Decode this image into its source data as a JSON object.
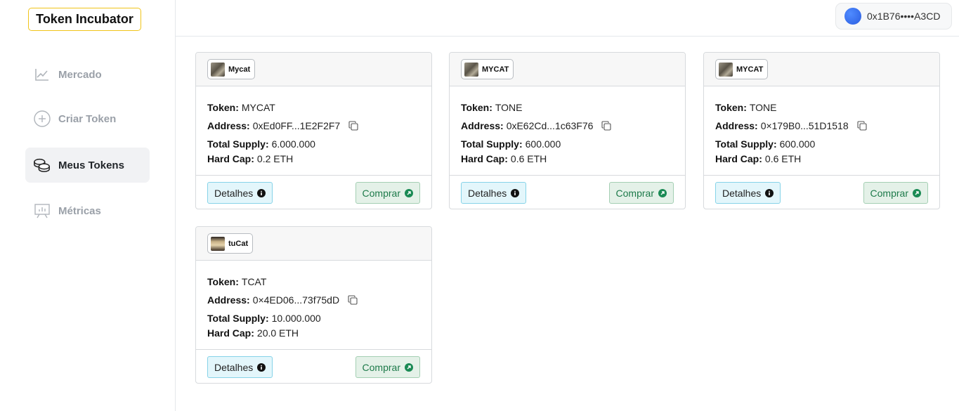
{
  "app": {
    "title": "Token Incubator"
  },
  "sidebar": {
    "items": [
      {
        "label": "Mercado",
        "icon": "chart-line-icon"
      },
      {
        "label": "Criar Token",
        "icon": "plus-circle-icon"
      },
      {
        "label": "Meus Tokens",
        "icon": "coins-icon",
        "active": true
      },
      {
        "label": "Métricas",
        "icon": "presentation-chart-icon"
      }
    ]
  },
  "header": {
    "wallet_address": "0x1B76••••A3CD"
  },
  "labels": {
    "token": "Token:",
    "address": "Address:",
    "total_supply": "Total Supply:",
    "hard_cap": "Hard Cap:",
    "details_button": "Detalhes",
    "buy_button": "Comprar"
  },
  "cards": [
    {
      "name": "Mycat",
      "symbol": "MYCAT",
      "address": "0xEd0FF...1E2F2F7",
      "total_supply": "6.000.000",
      "hard_cap": "0.2 ETH"
    },
    {
      "name": "MYCAT",
      "symbol": "TONE",
      "address": "0xE62Cd...1c63F76",
      "total_supply": "600.000",
      "hard_cap": "0.6 ETH"
    },
    {
      "name": "MYCAT",
      "symbol": "TONE",
      "address": "0×179B0...51D1518",
      "total_supply": "600.000",
      "hard_cap": "0.6 ETH"
    },
    {
      "name": "tuCat",
      "symbol": "TCAT",
      "address": "0×4ED06...73f75dD",
      "total_supply": "10.000.000",
      "hard_cap": "20.0 ETH"
    }
  ],
  "colors": {
    "accent_border": "#f0c419",
    "info": "#86d3e8",
    "success": "#1a8a54"
  }
}
